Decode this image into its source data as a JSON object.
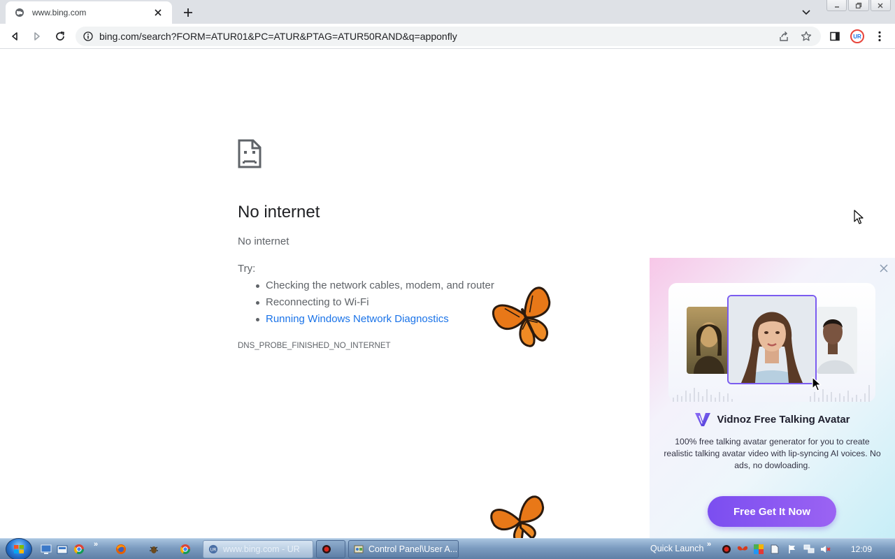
{
  "browser": {
    "tab_title": "www.bing.com",
    "url": "bing.com/search?FORM=ATUR01&PC=ATUR&PTAG=ATUR50RAND&q=apponfly",
    "profile_initials": "UR"
  },
  "error_page": {
    "icon": "sad-page-icon",
    "title": "No internet",
    "subtitle": "No internet",
    "try_label": "Try:",
    "suggestions": [
      "Checking the network cables, modem, and router",
      "Reconnecting to Wi-Fi"
    ],
    "diagnostics_link": "Running Windows Network Diagnostics",
    "error_code": "DNS_PROBE_FINISHED_NO_INTERNET"
  },
  "ad": {
    "brand": "Vidnoz Free Talking Avatar",
    "description": "100% free talking avatar generator for you to create realistic talking avatar video with lip-syncing AI voices. No ads, no dowloading.",
    "cta": "Free Get It Now",
    "accent_color": "#7b4ef0"
  },
  "taskbar": {
    "tasks": [
      {
        "label": "www.bing.com - UR",
        "icon": "chrome-icon",
        "active": true
      },
      {
        "label": "",
        "icon": "app-red-icon",
        "active": false
      },
      {
        "label": "Control Panel\\User A...",
        "icon": "control-panel-icon",
        "active": false
      }
    ],
    "quick_launch_label": "Quick Launch",
    "chevron": "»",
    "clock": "12:09"
  }
}
